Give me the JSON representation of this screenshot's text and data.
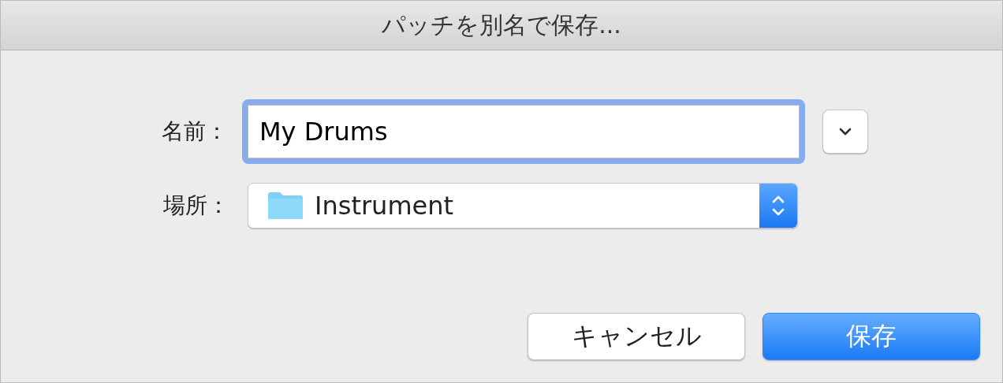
{
  "window": {
    "title": "パッチを別名で保存..."
  },
  "name_field": {
    "label": "名前：",
    "value": "My Drums",
    "focused": true
  },
  "location_field": {
    "label": "場所：",
    "value": "Instrument"
  },
  "buttons": [
    {
      "label": "キャンセル",
      "default": false
    },
    {
      "label": "保存",
      "default": true
    }
  ]
}
